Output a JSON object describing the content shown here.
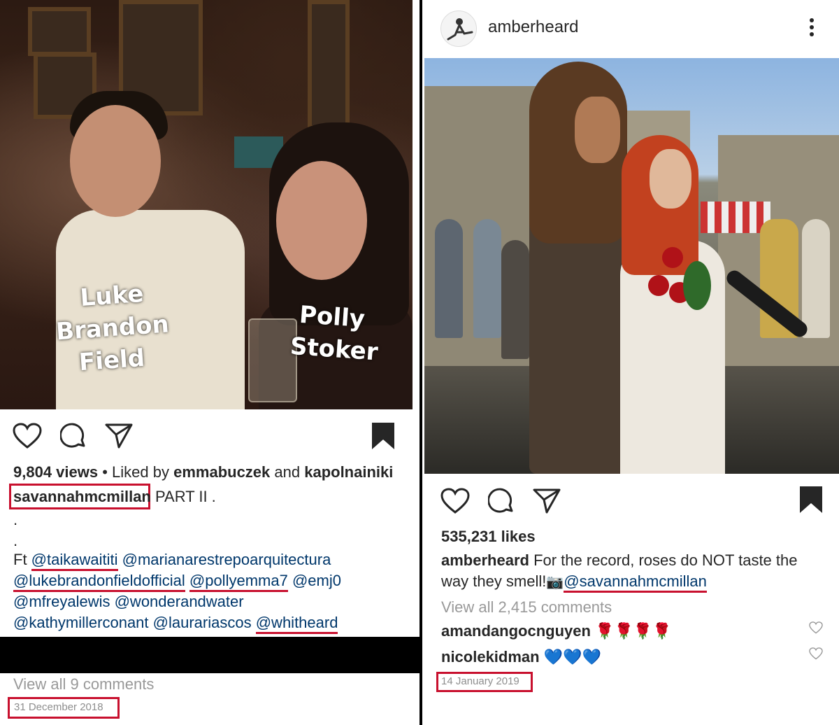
{
  "left_post": {
    "photo_labels": {
      "person1": [
        "Luke",
        "Brandon",
        "Field"
      ],
      "person2": [
        "Polly",
        "Stoker"
      ]
    },
    "views_count": "9,804 views",
    "liked_by_prefix": " • Liked by ",
    "liked_by_user1": "emmabuczek",
    "liked_by_and": " and ",
    "liked_by_user2": "kapolnainiki",
    "caption_user": "savannahmcmillan",
    "caption_text": " PART II .",
    "caption_dot1": ".",
    "caption_dot2": ".",
    "ft_prefix": "Ft ",
    "tags": {
      "t1": "@taikawaititi",
      "t2": "@marianarestrepoarquitectura",
      "t3": "@lukebrandonfieldofficial",
      "t4": "@pollyemma7",
      "t5": "@emj0",
      "t6": "@mfreyalewis",
      "t7": "@wonderandwater",
      "t8": "@kathymillerconant",
      "t9": "@laurariascos",
      "t10": "@whitheard"
    },
    "view_comments": "View all 9 comments",
    "date": "31 December 2018"
  },
  "right_post": {
    "header_username": "amberheard",
    "likes": "535,231 likes",
    "caption_user": "amberheard",
    "caption_line1": " For the record, roses do NOT taste the",
    "caption_line2": "way they smell!",
    "camera_emoji": "📷",
    "caption_tag": "@savannahmcmillan",
    "view_comments": "View all 2,415 comments",
    "comments": [
      {
        "user": "amandangocnguyen",
        "emoji": "🌹🌹🌹🌹"
      },
      {
        "user": "nicolekidman",
        "emoji": "💙💙💙"
      }
    ],
    "date": "14 January 2019"
  },
  "colors": {
    "highlight_red": "#c8102e",
    "tag_blue": "#00376b",
    "text": "#262626",
    "muted": "#999999"
  },
  "icons": [
    "heart-icon",
    "comment-icon",
    "share-icon",
    "bookmark-icon",
    "more-icon",
    "camera-emoji",
    "rose-emoji",
    "blue-heart-emoji"
  ]
}
